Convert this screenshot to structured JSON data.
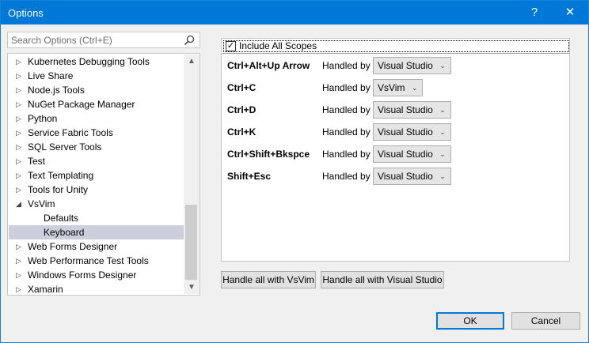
{
  "window": {
    "title": "Options",
    "help_glyph": "?",
    "close_glyph": "✕"
  },
  "search": {
    "placeholder": "Search Options (Ctrl+E)",
    "icon": "search-icon"
  },
  "tree": {
    "items": [
      {
        "label": "Kubernetes Debugging Tools",
        "expandable": true,
        "expanded": false
      },
      {
        "label": "Live Share",
        "expandable": true,
        "expanded": false
      },
      {
        "label": "Node.js Tools",
        "expandable": true,
        "expanded": false
      },
      {
        "label": "NuGet Package Manager",
        "expandable": true,
        "expanded": false
      },
      {
        "label": "Python",
        "expandable": true,
        "expanded": false
      },
      {
        "label": "Service Fabric Tools",
        "expandable": true,
        "expanded": false
      },
      {
        "label": "SQL Server Tools",
        "expandable": true,
        "expanded": false
      },
      {
        "label": "Test",
        "expandable": true,
        "expanded": false
      },
      {
        "label": "Text Templating",
        "expandable": true,
        "expanded": false
      },
      {
        "label": "Tools for Unity",
        "expandable": true,
        "expanded": false
      },
      {
        "label": "VsVim",
        "expandable": true,
        "expanded": true
      },
      {
        "label": "Defaults",
        "expandable": false,
        "child": true
      },
      {
        "label": "Keyboard",
        "expandable": false,
        "child": true,
        "selected": true
      },
      {
        "label": "Web Forms Designer",
        "expandable": true,
        "expanded": false
      },
      {
        "label": "Web Performance Test Tools",
        "expandable": true,
        "expanded": false
      },
      {
        "label": "Windows Forms Designer",
        "expandable": true,
        "expanded": false
      },
      {
        "label": "Xamarin",
        "expandable": true,
        "expanded": false
      }
    ],
    "collapsed_glyph": "▷",
    "expanded_glyph": "◢",
    "scroll_up_glyph": "▲",
    "scroll_down_glyph": "▼"
  },
  "keyboard": {
    "include_all_scopes": {
      "label": "Include All Scopes",
      "checked": true,
      "check_glyph": "✓"
    },
    "handled_by_label": "Handled by",
    "dropdown_chevron": "⌄",
    "rows": [
      {
        "keys": "Ctrl+Alt+Up Arrow",
        "handler": "Visual Studio"
      },
      {
        "keys": "Ctrl+C",
        "handler": "VsVim"
      },
      {
        "keys": "Ctrl+D",
        "handler": "Visual Studio"
      },
      {
        "keys": "Ctrl+K",
        "handler": "Visual Studio"
      },
      {
        "keys": "Ctrl+Shift+Bkspce",
        "handler": "Visual Studio"
      },
      {
        "keys": "Shift+Esc",
        "handler": "Visual Studio"
      }
    ]
  },
  "buttons": {
    "handle_all_vsvim": "Handle all with VsVim",
    "handle_all_vs": "Handle all with Visual Studio",
    "ok": "OK",
    "cancel": "Cancel"
  },
  "colors": {
    "titlebar": "#0078d7",
    "selection": "#cccedb"
  }
}
